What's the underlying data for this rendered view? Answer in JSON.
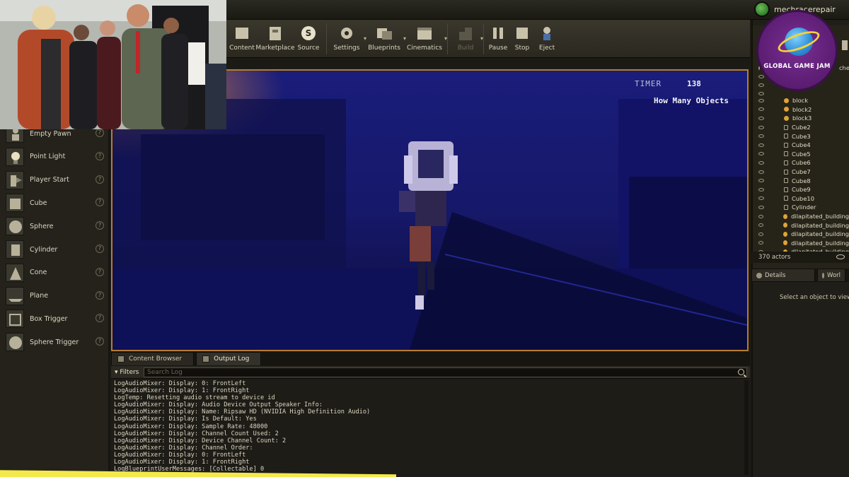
{
  "project_name": "mechracerepair",
  "toolbar": [
    {
      "label": "Content",
      "icon": "content-icon",
      "disabled": false
    },
    {
      "label": "Marketplace",
      "icon": "marketplace-icon",
      "disabled": false
    },
    {
      "label": "Source",
      "icon": "source-control-icon",
      "disabled": false
    },
    {
      "label": "Settings",
      "icon": "settings-icon",
      "disabled": false
    },
    {
      "label": "Blueprints",
      "icon": "blueprints-icon",
      "disabled": false
    },
    {
      "label": "Cinematics",
      "icon": "cinematics-icon",
      "disabled": false
    },
    {
      "label": "Build",
      "icon": "build-icon",
      "disabled": true
    },
    {
      "label": "Pause",
      "icon": "pause-icon",
      "disabled": false
    },
    {
      "label": "Stop",
      "icon": "stop-icon",
      "disabled": false
    },
    {
      "label": "Eject",
      "icon": "eject-icon",
      "disabled": false
    }
  ],
  "place_actors": [
    {
      "label": "Empty Pawn",
      "icon": "pawn-icon"
    },
    {
      "label": "Point Light",
      "icon": "light-bulb-icon"
    },
    {
      "label": "Player Start",
      "icon": "player-start-icon"
    },
    {
      "label": "Cube",
      "icon": "cube-icon"
    },
    {
      "label": "Sphere",
      "icon": "sphere-icon"
    },
    {
      "label": "Cylinder",
      "icon": "cylinder-icon"
    },
    {
      "label": "Cone",
      "icon": "cone-icon"
    },
    {
      "label": "Plane",
      "icon": "plane-icon"
    },
    {
      "label": "Box Trigger",
      "icon": "box-trigger-icon"
    },
    {
      "label": "Sphere Trigger",
      "icon": "sphere-trigger-icon"
    }
  ],
  "viewport": {
    "timer_label": "TIMER",
    "timer_value": "138",
    "objects_label": "How Many Objects"
  },
  "bottom_tabs": [
    {
      "label": "Content Browser",
      "active": false
    },
    {
      "label": "Output Log",
      "active": true
    }
  ],
  "filters_label": "Filters",
  "search_placeholder": "Search Log",
  "log_lines": [
    "LogAudioMixer: Display: 0: FrontLeft",
    "LogAudioMixer: Display: 1: FrontRight",
    "LogTemp: Resetting audio stream to device id",
    "LogAudioMixer: Display: Audio Device Output Speaker Info:",
    "LogAudioMixer: Display: Name: Ripsaw HD (NVIDIA High Definition Audio)",
    "LogAudioMixer: Display: Is Default: Yes",
    "LogAudioMixer: Display: Sample Rate: 48000",
    "LogAudioMixer: Display: Channel Count Used: 2",
    "LogAudioMixer: Display: Device Channel Count: 2",
    "LogAudioMixer: Display: Channel Order:",
    "LogAudioMixer: Display: 0: FrontLeft",
    "LogAudioMixer: Display: 1: FrontRight",
    "LogBlueprintUserMessages: [Collectable] 0"
  ],
  "outliner": {
    "header_fragment": "che",
    "items": [
      {
        "label": "block",
        "type": "actor"
      },
      {
        "label": "block2",
        "type": "actor"
      },
      {
        "label": "block3",
        "type": "actor"
      },
      {
        "label": "Cube2",
        "type": "mesh"
      },
      {
        "label": "Cube3",
        "type": "mesh"
      },
      {
        "label": "Cube4",
        "type": "mesh"
      },
      {
        "label": "Cube5",
        "type": "mesh"
      },
      {
        "label": "Cube6",
        "type": "mesh"
      },
      {
        "label": "Cube7",
        "type": "mesh"
      },
      {
        "label": "Cube8",
        "type": "mesh"
      },
      {
        "label": "Cube9",
        "type": "mesh"
      },
      {
        "label": "Cube10",
        "type": "mesh"
      },
      {
        "label": "Cylinder",
        "type": "mesh"
      },
      {
        "label": "dilapitated_building",
        "type": "actor"
      },
      {
        "label": "dilapitated_building",
        "type": "actor"
      },
      {
        "label": "dilapitated_building",
        "type": "actor"
      },
      {
        "label": "dilapitated_building",
        "type": "actor"
      },
      {
        "label": "dilapitated_building",
        "type": "actor"
      }
    ],
    "actor_count": "370 actors"
  },
  "details_tabs": [
    {
      "label": "Details"
    },
    {
      "label": "Worl"
    }
  ],
  "details_message": "Select an object to view de",
  "logo_text": "GLOBAL GAME JAM",
  "colors": {
    "viewport_border": "#b87d2a",
    "viewport_bg": "#0e1040",
    "panel_bg": "#24221b",
    "logo_purple": "#5f1f76"
  }
}
